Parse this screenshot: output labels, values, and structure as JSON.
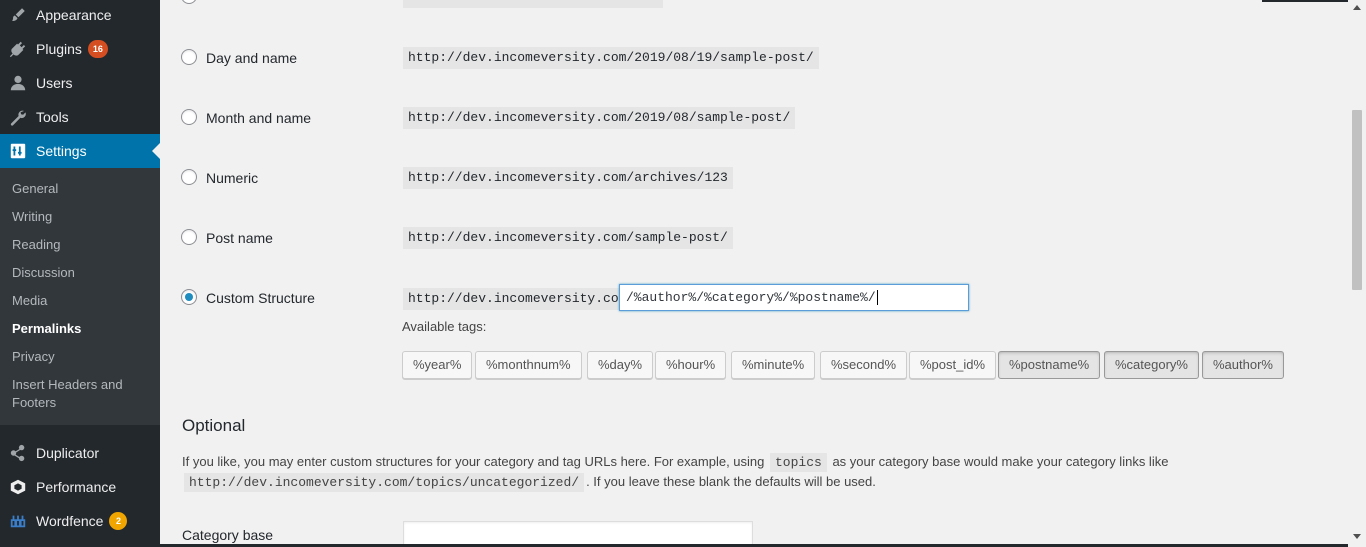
{
  "sidebar": {
    "menu": [
      {
        "label": "Appearance",
        "icon": "paintbrush-icon"
      },
      {
        "label": "Plugins",
        "icon": "plugin-icon",
        "badge": "16"
      },
      {
        "label": "Users",
        "icon": "users-icon"
      },
      {
        "label": "Tools",
        "icon": "wrench-icon"
      },
      {
        "label": "Settings",
        "icon": "settings-icon"
      }
    ],
    "submenu": [
      {
        "label": "General"
      },
      {
        "label": "Writing"
      },
      {
        "label": "Reading"
      },
      {
        "label": "Discussion"
      },
      {
        "label": "Media"
      },
      {
        "label": "Permalinks"
      },
      {
        "label": "Privacy"
      },
      {
        "label": "Insert Headers and Footers"
      }
    ],
    "bottom_menu": [
      {
        "label": "Duplicator",
        "icon": "duplicator-icon"
      },
      {
        "label": "Performance",
        "icon": "performance-icon"
      },
      {
        "label": "Wordfence",
        "icon": "wordfence-icon",
        "badge": "2"
      }
    ]
  },
  "permalink_options": [
    {
      "label": "Day and name",
      "example": "http://dev.incomeversity.com/2019/08/19/sample-post/",
      "checked": false
    },
    {
      "label": "Month and name",
      "example": "http://dev.incomeversity.com/2019/08/sample-post/",
      "checked": false
    },
    {
      "label": "Numeric",
      "example": "http://dev.incomeversity.com/archives/123",
      "checked": false
    },
    {
      "label": "Post name",
      "example": "http://dev.incomeversity.com/sample-post/",
      "checked": false
    },
    {
      "label": "Custom Structure",
      "example": "http://dev.incomeversity.com",
      "checked": true
    }
  ],
  "custom_structure_value": "/%author%/%category%/%postname%/",
  "available_tags_label": "Available tags:",
  "tags": [
    {
      "label": "%year%",
      "active": false
    },
    {
      "label": "%monthnum%",
      "active": false
    },
    {
      "label": "%day%",
      "active": false
    },
    {
      "label": "%hour%",
      "active": false
    },
    {
      "label": "%minute%",
      "active": false
    },
    {
      "label": "%second%",
      "active": false
    },
    {
      "label": "%post_id%",
      "active": false
    },
    {
      "label": "%postname%",
      "active": true
    },
    {
      "label": "%category%",
      "active": true
    },
    {
      "label": "%author%",
      "active": true
    }
  ],
  "optional": {
    "title": "Optional",
    "desc_part1": "If you like, you may enter custom structures for your category and tag URLs here. For example, using",
    "desc_code1": "topics",
    "desc_part2": "as your category base would make your category links like",
    "desc_code2": "http://dev.incomeversity.com/topics/uncategorized/",
    "desc_part3": ". If you leave these blank the defaults will be used.",
    "category_base_label": "Category base",
    "category_base_value": ""
  },
  "colors": {
    "sidebar_bg": "#23282d",
    "submenu_bg": "#32373c",
    "accent": "#0073aa",
    "badge_red": "#d54e21",
    "badge_orange": "#f0a500"
  }
}
